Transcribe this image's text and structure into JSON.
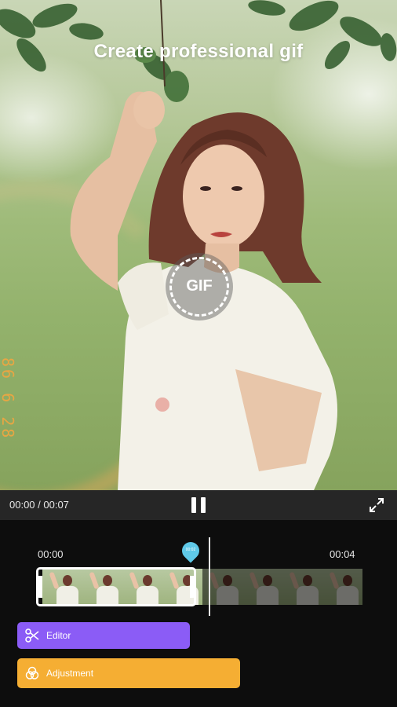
{
  "hero": {
    "title": "Create professional gif",
    "badge_label": "GIF",
    "date_stamp": "86 6 28"
  },
  "player": {
    "time_readout": "00:00 / 00:07",
    "pause_icon": "pause-icon",
    "fullscreen_icon": "expand-icon"
  },
  "timeline": {
    "start_label": "00:00",
    "end_label": "00:04",
    "playhead_label": "00:02",
    "selected_fraction": 0.5
  },
  "actions": {
    "editor_label": "Editor",
    "editor_icon": "scissors-icon",
    "editor_color": "#8b5cf6",
    "adjustment_label": "Adjustment",
    "adjustment_icon": "filters-icon",
    "adjustment_color": "#f5ae33"
  },
  "colors": {
    "player_bar": "#262626",
    "background": "#0d0d0d",
    "playhead": "#5fc9e8"
  }
}
